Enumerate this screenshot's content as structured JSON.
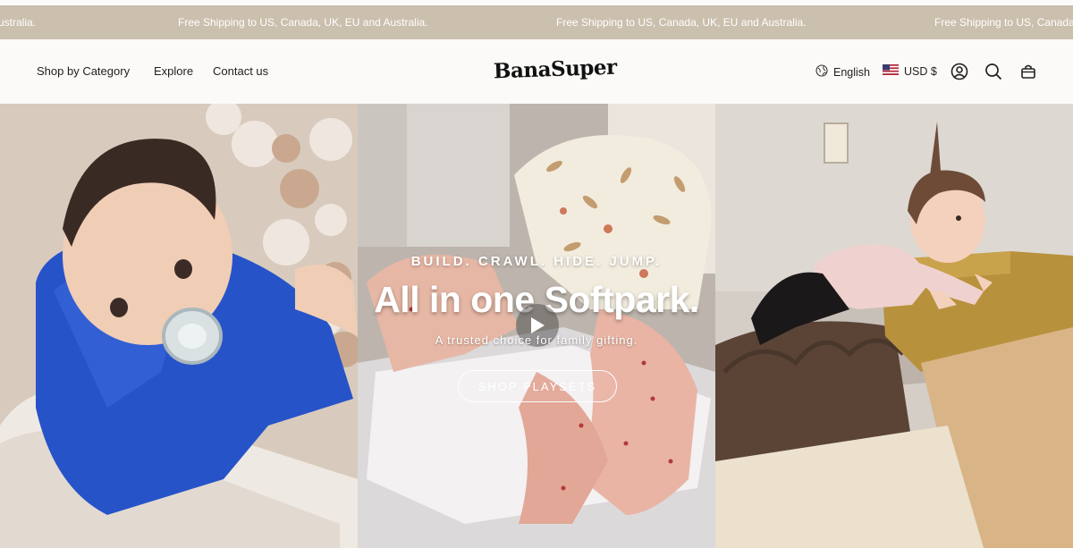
{
  "announcement": {
    "messages": [
      "ustralia.",
      "Free Shipping to US, Canada, UK, EU and Australia.",
      "Free Shipping to US, Canada, UK, EU and Australia.",
      "Free Shipping to US, Canada,"
    ]
  },
  "nav": {
    "items": [
      "Shop by Category",
      "Explore",
      "Contact us"
    ]
  },
  "logo": {
    "text": "BanaSuper"
  },
  "utilities": {
    "language": "English",
    "currency": "USD $",
    "icons": [
      "globe-icon",
      "us-flag-icon",
      "account-icon",
      "search-icon",
      "cart-icon"
    ]
  },
  "hero": {
    "eyebrow": "BUILD. CRAWL. HIDE. JUMP.",
    "headline": "All in one Softpark.",
    "subtitle": "A trusted choice for family gifting.",
    "cta_label": "SHOP PLAYSETS",
    "colors": {
      "banner": "#cbbfad",
      "text": "#ffffff"
    }
  }
}
